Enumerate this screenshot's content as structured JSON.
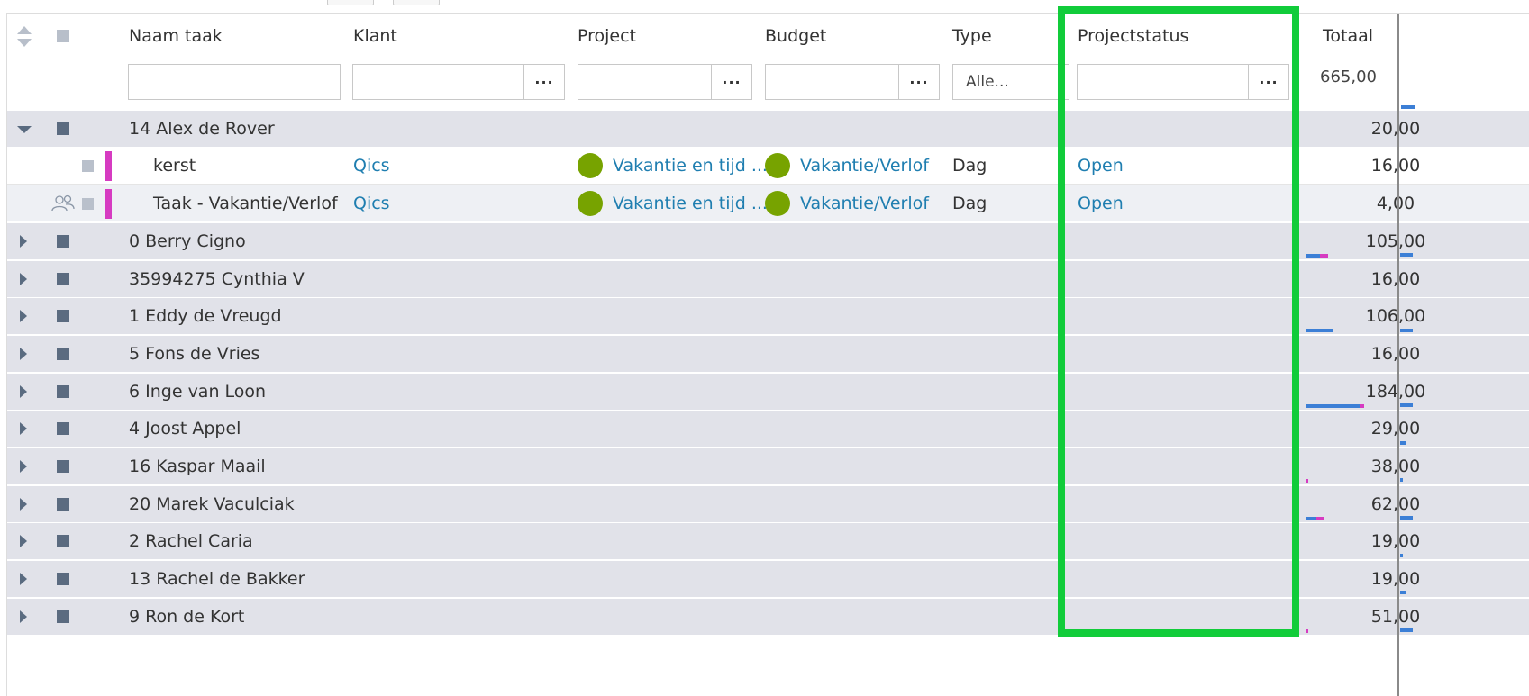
{
  "columns": {
    "naam_taak": "Naam taak",
    "klant": "Klant",
    "project": "Project",
    "budget": "Budget",
    "type": "Type",
    "projectstatus": "Projectstatus",
    "totaal": "Totaal"
  },
  "filters": {
    "type_value": "Alle...",
    "more": "···",
    "total_sum": "665,00"
  },
  "expanded_group": {
    "label": "14 Alex de Rover",
    "total": "20,00",
    "tasks": [
      {
        "name": "kerst",
        "klant": "Qics",
        "project": "Vakantie en tijd ...",
        "budget": "Vakantie/Verlof",
        "type": "Dag",
        "status": "Open",
        "total": "16,00"
      },
      {
        "name": "Taak - Vakantie/Verlof",
        "klant": "Qics",
        "project": "Vakantie en tijd ...",
        "budget": "Vakantie/Verlof",
        "type": "Dag",
        "status": "Open",
        "total": "4,00"
      }
    ]
  },
  "groups": [
    {
      "label": "0 Berry Cigno",
      "total": "105,00"
    },
    {
      "label": "35994275 Cynthia V",
      "total": "16,00"
    },
    {
      "label": "1 Eddy de Vreugd",
      "total": "106,00"
    },
    {
      "label": "5 Fons de Vries",
      "total": "16,00"
    },
    {
      "label": "6 Inge van Loon",
      "total": "184,00"
    },
    {
      "label": "4 Joost Appel",
      "total": "29,00"
    },
    {
      "label": "16 Kaspar Maail",
      "total": "38,00"
    },
    {
      "label": "20 Marek Vaculciak",
      "total": "62,00"
    },
    {
      "label": "2 Rachel Caria",
      "total": "19,00"
    },
    {
      "label": "13 Rachel de Bakker",
      "total": "19,00"
    },
    {
      "label": "9 Ron de Kort",
      "total": "51,00"
    }
  ],
  "icons": {
    "sort": "sort-icon",
    "expand": "chevron-right-icon",
    "collapse": "chevron-down-icon",
    "team": "users-icon"
  },
  "colors": {
    "highlight": "#11cc3a",
    "link": "#1f7eb0",
    "project_dot": "#77a300",
    "task_marker": "#d63bc1",
    "group_bg": "#e1e2e9"
  }
}
